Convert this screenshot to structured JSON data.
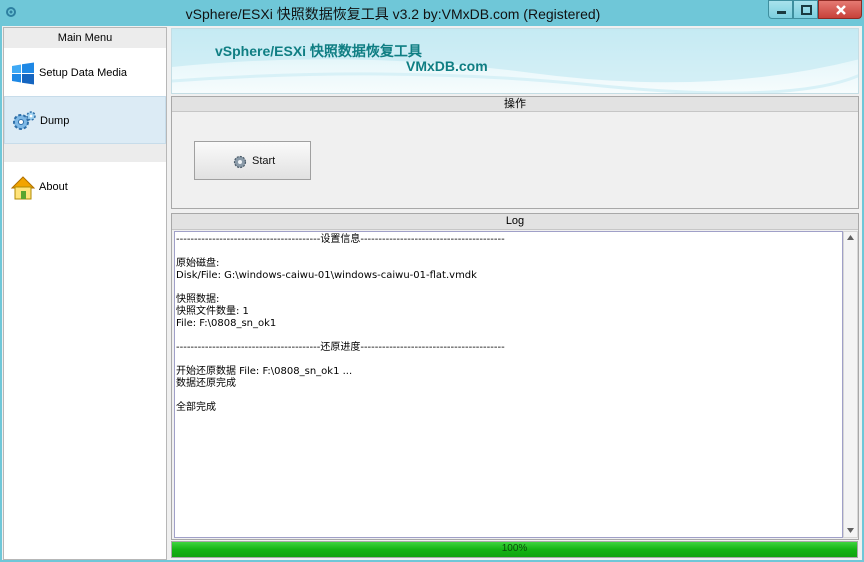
{
  "window": {
    "title": "vSphere/ESXi 快照数据恢复工具 v3.2 by:VMxDB.com (Registered)"
  },
  "sidebar": {
    "header": "Main Menu",
    "items": [
      {
        "label": "Setup Data Media",
        "icon": "windows-icon",
        "active": false
      },
      {
        "label": "Dump",
        "icon": "gears-icon",
        "active": true
      },
      {
        "label": "About",
        "icon": "house-icon",
        "active": false
      }
    ]
  },
  "banner": {
    "line1": "vSphere/ESXi 快照数据恢复工具",
    "line2": "VMxDB.com"
  },
  "operations": {
    "header": "操作",
    "start_label": "Start"
  },
  "log": {
    "header": "Log",
    "lines": [
      "----------------------------------------设置信息----------------------------------------",
      "",
      "原始磁盘:",
      "Disk/File: G:\\windows-caiwu-01\\windows-caiwu-01-flat.vmdk",
      "",
      "快照数据:",
      "快照文件数量: 1",
      "File: F:\\0808_sn_ok1",
      "",
      "----------------------------------------还原进度----------------------------------------",
      "",
      "开始还原数据 File: F:\\0808_sn_ok1 ...",
      "数据还原完成",
      "",
      "全部完成"
    ]
  },
  "progress": {
    "percent": 100,
    "label": "100%"
  },
  "colors": {
    "title_bar": "#6fc7d8",
    "banner_text": "#0f7e83",
    "progress_green": "#14b414",
    "close_button": "#c7413a"
  }
}
